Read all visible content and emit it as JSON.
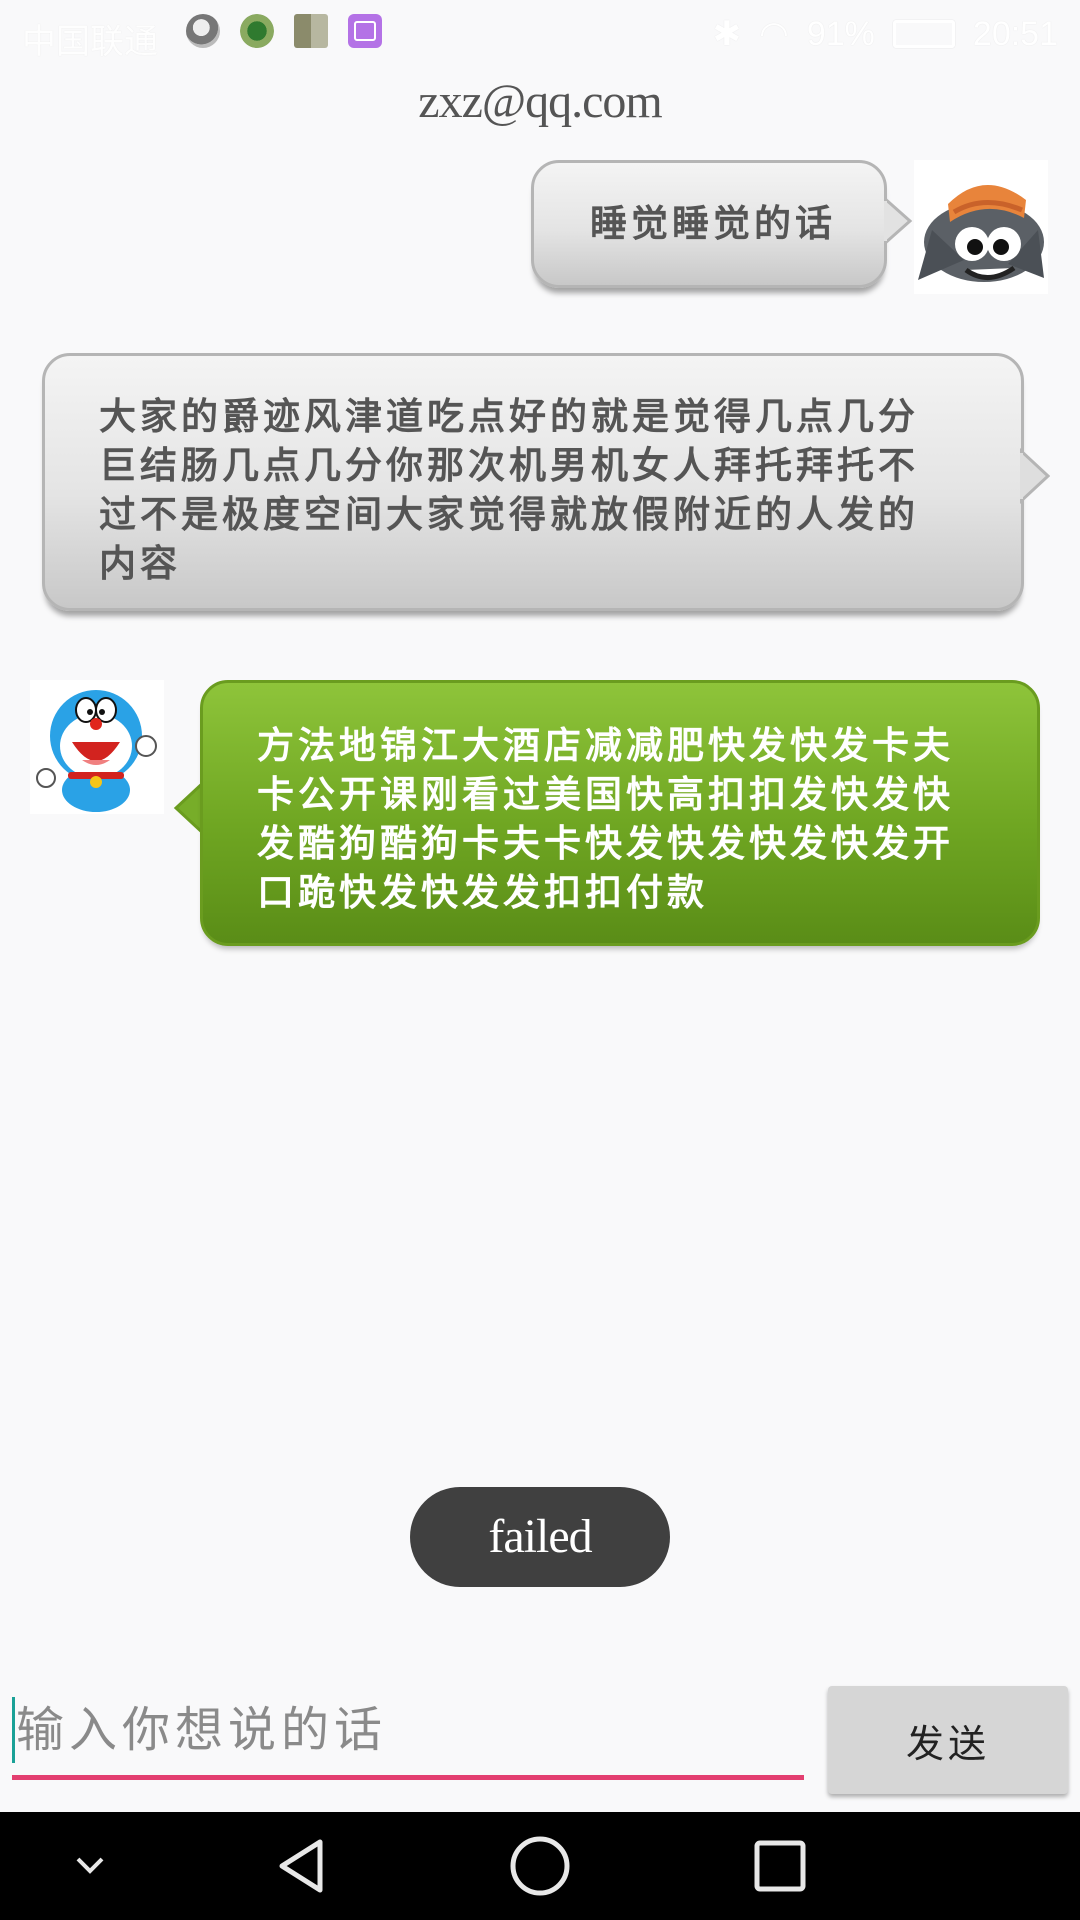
{
  "status_bar": {
    "carrier": "中国联通",
    "battery": "91%",
    "time": "20:51",
    "notification_icons": [
      "pig-app-icon",
      "leaf-app-icon",
      "gallery-app-icon",
      "image-app-icon"
    ]
  },
  "header": {
    "title": "zxz@qq.com"
  },
  "messages": [
    {
      "side": "right",
      "style": "gray",
      "avatar": "grey-wolf-avatar",
      "text": "睡觉睡觉的话"
    },
    {
      "side": "right",
      "style": "gray",
      "avatar": "",
      "text": "大家的爵迹风津道吃点好的就是觉得几点几分巨结肠几点几分你那次机男机女人拜托拜托不过不是极度空间大家觉得就放假附近的人发的内容"
    },
    {
      "side": "left",
      "style": "green",
      "avatar": "doraemon-avatar",
      "text": "方法地锦江大酒店减减肥快发快发卡夫卡公开课刚看过美国快高扣扣发快发快发酷狗酷狗卡夫卡快发快发快发快发开口跪快发快发发扣扣付款"
    }
  ],
  "toast": {
    "text": "failed"
  },
  "composer": {
    "placeholder": "输入你想说的话",
    "value": "",
    "send_label": "发送"
  },
  "colors": {
    "accent_underline": "#e33f70",
    "caret": "#1aa197",
    "green_bubble": "#6fa622",
    "gray_bubble": "#e4e4e4"
  },
  "nav_bar": {
    "buttons": [
      "chevron-down-icon",
      "back-icon",
      "home-icon",
      "recents-icon"
    ]
  }
}
